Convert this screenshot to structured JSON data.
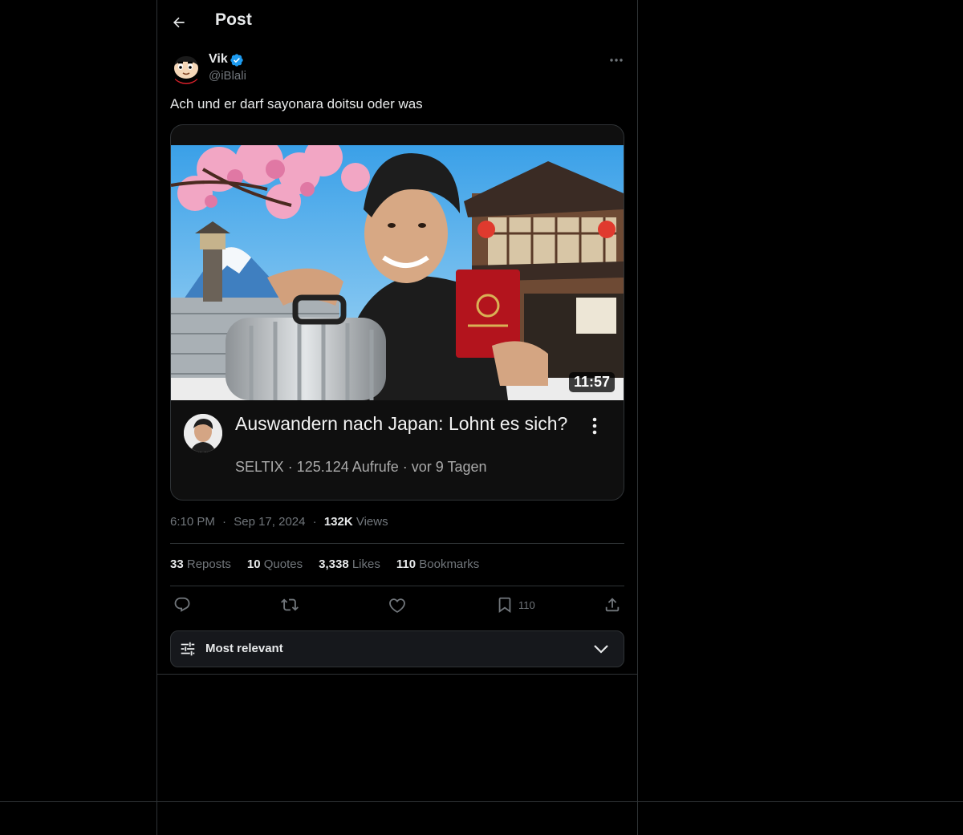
{
  "header": {
    "title": "Post"
  },
  "post": {
    "author_name": "Vik",
    "author_handle": "@iBlali",
    "text": "Ach und er darf sayonara doitsu oder was",
    "media": {
      "video_title": "Auswandern nach Japan: Lohnt es sich?",
      "video_meta": "SELTIX · 125.124 Aufrufe · vor 9 Tagen",
      "duration": "11:57"
    },
    "time": "6:10 PM",
    "date": "Sep 17, 2024",
    "views_count": "132K",
    "views_label": "Views",
    "separator": "·"
  },
  "stats": {
    "reposts_count": "33",
    "reposts_label": "Reposts",
    "quotes_count": "10",
    "quotes_label": "Quotes",
    "likes_count": "3,338",
    "likes_label": "Likes",
    "bookmarks_count": "110",
    "bookmarks_label": "Bookmarks"
  },
  "actions": {
    "reply_icon": "reply-icon",
    "repost_icon": "repost-icon",
    "like_icon": "heart-icon",
    "bookmark_icon": "bookmark-icon",
    "bookmark_count": "110",
    "share_icon": "share-icon"
  },
  "sort": {
    "label": "Most relevant"
  },
  "colors": {
    "background": "#000000",
    "text_primary": "#e7e9ea",
    "text_secondary": "#71767b",
    "border": "#2f3336",
    "verified_blue": "#1d9bf0"
  }
}
